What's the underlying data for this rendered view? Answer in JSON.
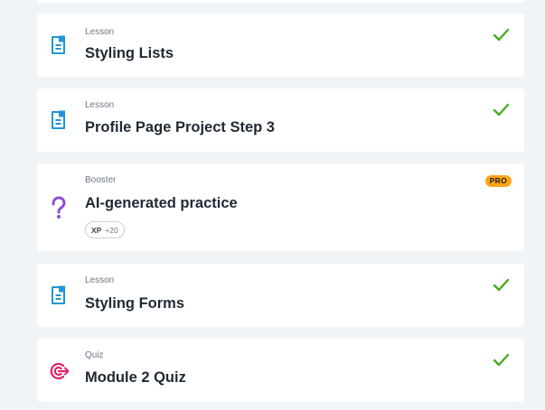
{
  "colors": {
    "background": "#f1f4f7",
    "lesson_icon": "#2196d6",
    "booster_icon": "#8d4fd6",
    "quiz_icon": "#e0246e",
    "check": "#4aaa1f",
    "pro_badge": "#ffa516"
  },
  "items": [
    {
      "type": "Lesson",
      "title": "Styling Lists",
      "icon": "lesson-icon",
      "completed": true
    },
    {
      "type": "Lesson",
      "title": "Profile Page Project Step 3",
      "icon": "lesson-icon",
      "completed": true
    },
    {
      "type": "Booster",
      "title": "AI-generated practice",
      "icon": "question-icon",
      "badge": "PRO",
      "xp_label": "XP",
      "xp_value": "+20",
      "completed": false
    },
    {
      "type": "Lesson",
      "title": "Styling Forms",
      "icon": "lesson-icon",
      "completed": true
    },
    {
      "type": "Quiz",
      "title": "Module 2 Quiz",
      "icon": "target-icon",
      "completed": true
    }
  ]
}
